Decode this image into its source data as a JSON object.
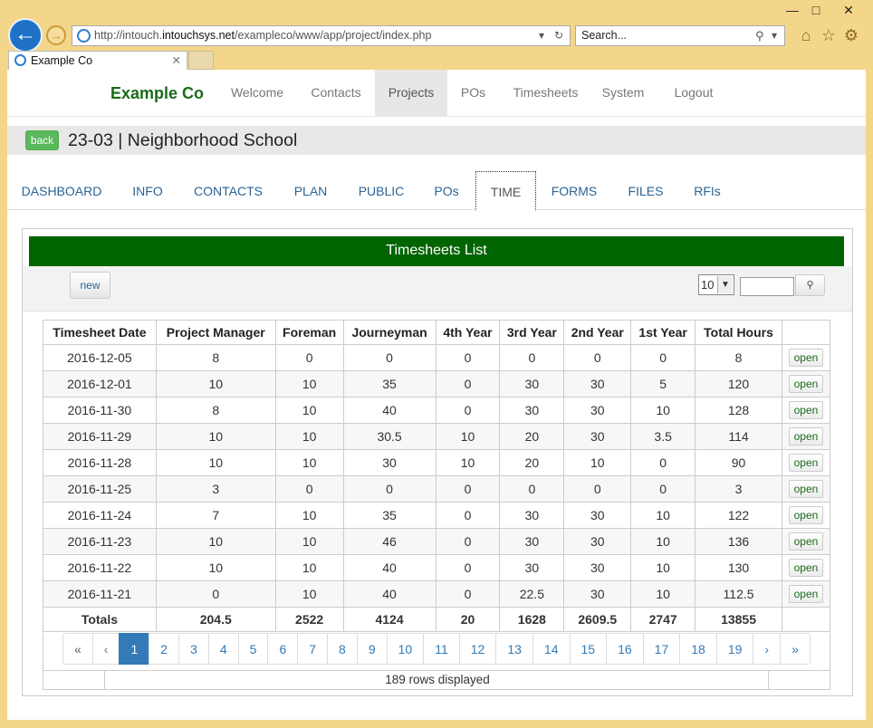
{
  "window": {
    "min": "—",
    "max": "□",
    "close": "✕"
  },
  "browser": {
    "url_pre": "http://intouch.",
    "url_host": "intouchsys.net",
    "url_post": "/exampleco/www/app/project/index.php",
    "search_placeholder": "Search...",
    "tab_title": "Example Co"
  },
  "topnav": {
    "brand": "Example Co",
    "items": [
      "Welcome",
      "Contacts",
      "Projects",
      "POs",
      "Timesheets",
      "System",
      "Logout"
    ],
    "active": "Projects"
  },
  "project": {
    "back_label": "back",
    "title": "23-03 | Neighborhood School"
  },
  "subnav": {
    "items": [
      "DASHBOARD",
      "INFO",
      "CONTACTS",
      "PLAN",
      "PUBLIC",
      "POs",
      "TIME",
      "FORMS",
      "FILES",
      "RFIs"
    ],
    "active": "TIME"
  },
  "panel": {
    "title": "Timesheets List",
    "new_label": "new",
    "page_size": "10",
    "columns": [
      "Timesheet Date",
      "Project Manager",
      "Foreman",
      "Journeyman",
      "4th Year",
      "3rd Year",
      "2nd Year",
      "1st Year",
      "Total Hours"
    ],
    "rows": [
      [
        "2016-12-05",
        "8",
        "0",
        "0",
        "0",
        "0",
        "0",
        "0",
        "8"
      ],
      [
        "2016-12-01",
        "10",
        "10",
        "35",
        "0",
        "30",
        "30",
        "5",
        "120"
      ],
      [
        "2016-11-30",
        "8",
        "10",
        "40",
        "0",
        "30",
        "30",
        "10",
        "128"
      ],
      [
        "2016-11-29",
        "10",
        "10",
        "30.5",
        "10",
        "20",
        "30",
        "3.5",
        "114"
      ],
      [
        "2016-11-28",
        "10",
        "10",
        "30",
        "10",
        "20",
        "10",
        "0",
        "90"
      ],
      [
        "2016-11-25",
        "3",
        "0",
        "0",
        "0",
        "0",
        "0",
        "0",
        "3"
      ],
      [
        "2016-11-24",
        "7",
        "10",
        "35",
        "0",
        "30",
        "30",
        "10",
        "122"
      ],
      [
        "2016-11-23",
        "10",
        "10",
        "46",
        "0",
        "30",
        "30",
        "10",
        "136"
      ],
      [
        "2016-11-22",
        "10",
        "10",
        "40",
        "0",
        "30",
        "30",
        "10",
        "130"
      ],
      [
        "2016-11-21",
        "0",
        "10",
        "40",
        "0",
        "22.5",
        "30",
        "10",
        "112.5"
      ]
    ],
    "open_label": "open",
    "totals": [
      "Totals",
      "204.5",
      "2522",
      "4124",
      "20",
      "1628",
      "2609.5",
      "2747",
      "13855"
    ],
    "pager": [
      "«",
      "‹",
      "1",
      "2",
      "3",
      "4",
      "5",
      "6",
      "7",
      "8",
      "9",
      "10",
      "11",
      "12",
      "13",
      "14",
      "15",
      "16",
      "17",
      "18",
      "19",
      "›",
      "»"
    ],
    "current_page": "1",
    "rows_displayed": "189 rows displayed"
  }
}
